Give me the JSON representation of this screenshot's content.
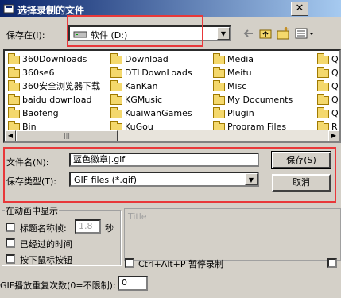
{
  "window": {
    "title": "选择录制的文件",
    "close_glyph": "✕"
  },
  "lookin": {
    "label": "保存在(I):",
    "value": "软件 (D:)"
  },
  "toolbar": {
    "icons": [
      "back-arrow-icon",
      "up-folder-icon",
      "new-folder-icon",
      "view-menu-icon"
    ]
  },
  "files": {
    "columns": [
      [
        "360Downloads",
        "360se6",
        "360安全浏览器下载",
        "baidu download",
        "Baofeng",
        "Bin"
      ],
      [
        "Download",
        "DTLDownLoads",
        "KanKan",
        "KGMusic",
        "KuaiwanGames",
        "KuGou"
      ],
      [
        "Media",
        "Meitu",
        "Misc",
        "My Documents",
        "Plugin",
        "Program Files"
      ],
      [
        "Q",
        "Q",
        "Q",
        "Q",
        "Q",
        "R"
      ]
    ]
  },
  "filename": {
    "label": "文件名(N):",
    "value": "蓝色徽章|.gif"
  },
  "filetype": {
    "label": "保存类型(T):",
    "value": "GIF files (*.gif)"
  },
  "buttons": {
    "save": "保存(S)",
    "cancel": "取消"
  },
  "animation": {
    "group_label": "在动画中显示",
    "title_frame_label": "标题名称帧:",
    "title_frame_value": "1.8",
    "seconds_unit": "秒",
    "elapsed_time_label": "已经过的时间",
    "mouse_button_label": "按下鼠标按钮"
  },
  "title_area": {
    "placeholder": "Title"
  },
  "pause_hotkey": {
    "label": "Ctrl+Alt+P 暂停录制"
  },
  "repeat": {
    "label": "GIF播放重复次数(0=不限制):",
    "value": "0"
  },
  "colors": {
    "highlight_box": "#e8383a",
    "title_bar_start": "#0a246a",
    "title_bar_end": "#a6caf0"
  }
}
